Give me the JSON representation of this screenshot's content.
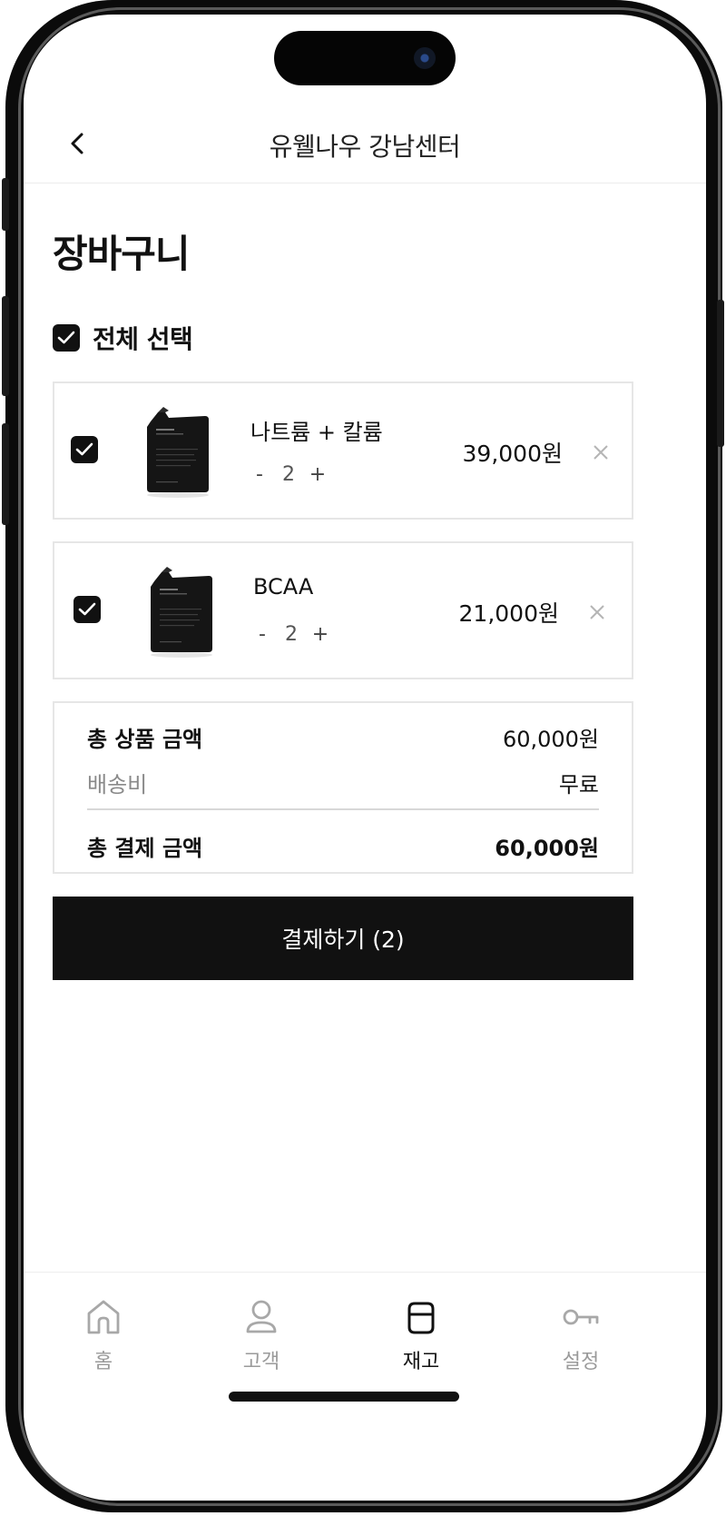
{
  "header": {
    "title": "유웰나우 강남센터"
  },
  "page_title": "장바구니",
  "select_all": {
    "label": "전체 선택",
    "checked": true
  },
  "cart_items": [
    {
      "name": "나트륨 + 칼륨",
      "quantity": "2",
      "price": "39,000원",
      "checked": true,
      "minus": "-",
      "plus": "+"
    },
    {
      "name": "BCAA",
      "quantity": "2",
      "price": "21,000원",
      "checked": true,
      "minus": "-",
      "plus": "+"
    }
  ],
  "summary": {
    "product_total_label": "총 상품 금액",
    "product_total_value": "60,000원",
    "shipping_label": "배송비",
    "shipping_value": "무료",
    "payment_total_label": "총 결제 금액",
    "payment_total_value": "60,000원"
  },
  "pay_button": {
    "label": "결제하기 (2)"
  },
  "tabbar": {
    "tabs": [
      {
        "label": "홈",
        "icon": "home-icon",
        "active": false
      },
      {
        "label": "고객",
        "icon": "person-icon",
        "active": false
      },
      {
        "label": "재고",
        "icon": "box-icon",
        "active": true
      },
      {
        "label": "설정",
        "icon": "key-icon",
        "active": false
      }
    ]
  },
  "colors": {
    "primary": "#111111",
    "border": "#e6e6e6",
    "muted_text": "#9a9a9a"
  }
}
